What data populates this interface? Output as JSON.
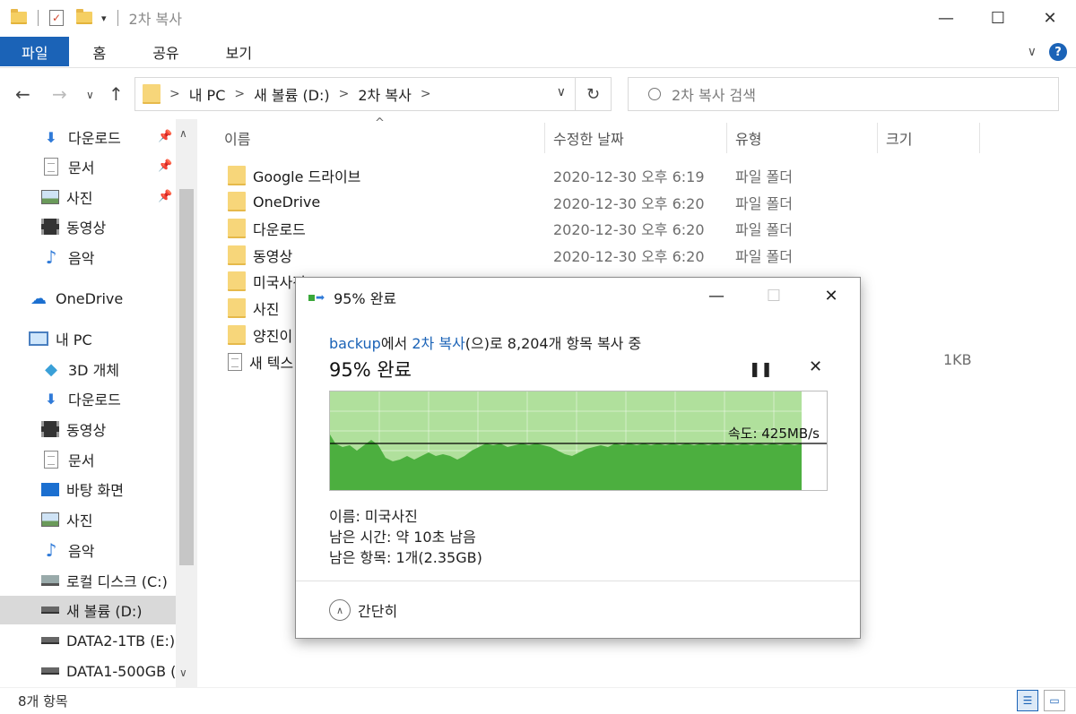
{
  "window": {
    "title": "2차 복사",
    "minimize": "—",
    "maximize": "☐",
    "close": "✕"
  },
  "ribbon": {
    "tabs": [
      "파일",
      "홈",
      "공유",
      "보기"
    ],
    "expand": "∨",
    "help": "?"
  },
  "nav": {
    "back": "←",
    "forward": "→",
    "recent": "∨",
    "up": "↑",
    "breadcrumb": [
      "내 PC",
      "새 볼륨 (D:)",
      "2차 복사"
    ],
    "dropdown": "∨",
    "refresh": "↻",
    "search_placeholder": "2차 복사 검색"
  },
  "sidebar": {
    "quick_access": [
      {
        "label": "다운로드",
        "icon": "download-arrow-icon",
        "pinned": true
      },
      {
        "label": "문서",
        "icon": "document-icon",
        "pinned": true
      },
      {
        "label": "사진",
        "icon": "picture-icon",
        "pinned": true
      },
      {
        "label": "동영상",
        "icon": "video-icon",
        "pinned": false
      },
      {
        "label": "음악",
        "icon": "music-note-icon",
        "pinned": false
      }
    ],
    "onedrive": "OneDrive",
    "this_pc": "내 PC",
    "pc_items": [
      {
        "label": "3D 개체",
        "icon": "3d-object-icon"
      },
      {
        "label": "다운로드",
        "icon": "download-arrow-icon"
      },
      {
        "label": "동영상",
        "icon": "video-icon"
      },
      {
        "label": "문서",
        "icon": "document-icon"
      },
      {
        "label": "바탕 화면",
        "icon": "desktop-icon"
      },
      {
        "label": "사진",
        "icon": "picture-icon"
      },
      {
        "label": "음악",
        "icon": "music-note-icon"
      },
      {
        "label": "로컬 디스크 (C:)",
        "icon": "local-disk-icon"
      },
      {
        "label": "새 볼륨 (D:)",
        "icon": "drive-icon",
        "selected": true
      },
      {
        "label": "DATA2-1TB (E:)",
        "icon": "drive-icon"
      },
      {
        "label": "DATA1-500GB (",
        "icon": "drive-icon"
      }
    ]
  },
  "columns": {
    "name": "이름",
    "modified": "수정한 날짜",
    "type": "유형",
    "size": "크기",
    "sort_indicator": "^"
  },
  "files": [
    {
      "name": "Google 드라이브",
      "date": "2020-12-30 오후 6:19",
      "type": "파일 폴더",
      "size": "",
      "icon": "folder-icon"
    },
    {
      "name": "OneDrive",
      "date": "2020-12-30 오후 6:20",
      "type": "파일 폴더",
      "size": "",
      "icon": "folder-icon"
    },
    {
      "name": "다운로드",
      "date": "2020-12-30 오후 6:20",
      "type": "파일 폴더",
      "size": "",
      "icon": "folder-icon"
    },
    {
      "name": "동영상",
      "date": "2020-12-30 오후 6:20",
      "type": "파일 폴더",
      "size": "",
      "icon": "folder-icon"
    },
    {
      "name": "미국사진",
      "date": "",
      "type": "",
      "size": "",
      "icon": "folder-icon"
    },
    {
      "name": "사진",
      "date": "",
      "type": "",
      "size": "",
      "icon": "folder-icon"
    },
    {
      "name": "양진이",
      "date": "",
      "type": "",
      "size": "",
      "icon": "folder-icon"
    },
    {
      "name": "새 텍스",
      "date": "",
      "type": "",
      "size": "1KB",
      "icon": "text-file-icon"
    }
  ],
  "status": {
    "item_count": "8개 항목"
  },
  "copy_dialog": {
    "title": "95% 완료",
    "minimize": "—",
    "maximize": "☐",
    "close": "✕",
    "subtitle": {
      "source": "backup",
      "mid1": "에서 ",
      "dest": "2차 복사",
      "mid2": "(으)로 8,204개 항목 복사 중"
    },
    "progress_heading": "95% 완료",
    "progress_fraction": 0.95,
    "pause": "❚❚",
    "cancel": "✕",
    "speed_label": "속도: 425MB/s",
    "speed_value_mbps": 425,
    "name_line": "이름: 미국사진",
    "time_line": "남은 시간: 약 10초 남음",
    "items_line": "남은 항목: 1개(2.35GB)",
    "less_details": "간단히",
    "colors": {
      "graph_fill": "#4caf3f",
      "graph_done_bg": "#b0e09c",
      "link": "#1b63b7"
    }
  }
}
